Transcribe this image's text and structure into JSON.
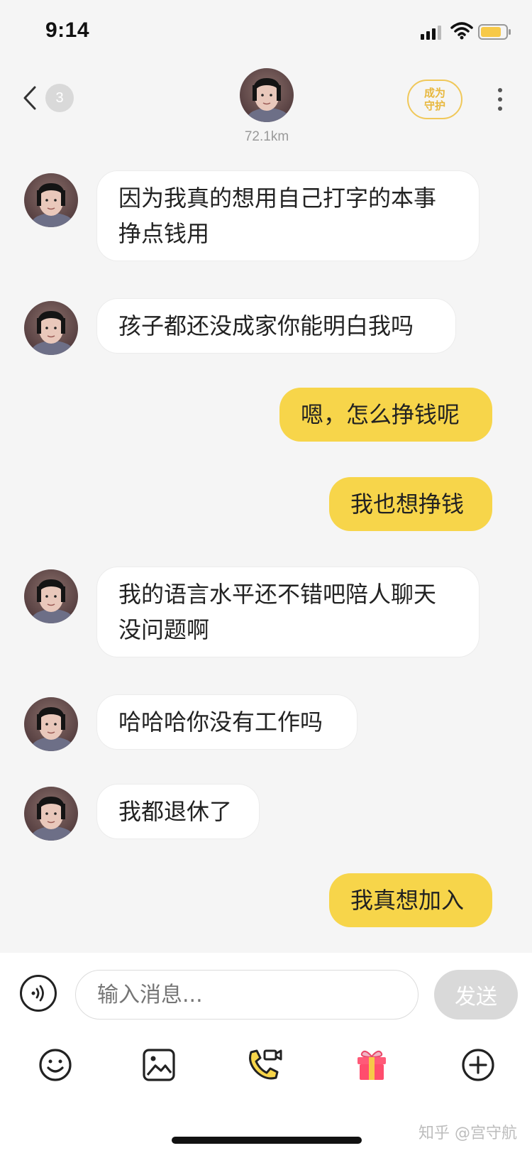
{
  "status_bar": {
    "time": "9:14"
  },
  "header": {
    "unread_count": "3",
    "distance": "72.1km",
    "guard_button": [
      "成为",
      "守护"
    ]
  },
  "messages": [
    {
      "side": "left",
      "text_lines": [
        "因为我真的想用自己打字的本事",
        "挣点钱用"
      ]
    },
    {
      "side": "left",
      "text_lines": [
        "孩子都还没成家你能明白我吗"
      ]
    },
    {
      "side": "right",
      "text_lines": [
        "嗯，怎么挣钱呢"
      ]
    },
    {
      "side": "right",
      "text_lines": [
        "我也想挣钱"
      ]
    },
    {
      "side": "left",
      "text_lines": [
        "我的语言水平还不错吧陪人聊天",
        "没问题啊"
      ]
    },
    {
      "side": "left",
      "text_lines": [
        "哈哈哈你没有工作吗"
      ]
    },
    {
      "side": "left",
      "text_lines": [
        "我都退休了"
      ]
    },
    {
      "side": "right",
      "text_lines": [
        "我真想加入"
      ]
    }
  ],
  "composer": {
    "placeholder": "输入消息...",
    "send_label": "发送"
  },
  "toolbar": {
    "icons": [
      "emoji-icon",
      "image-icon",
      "call-icon",
      "gift-icon",
      "plus-icon"
    ]
  },
  "watermark": "知乎 @宫守航",
  "colors": {
    "accent": "#f7d54a",
    "background": "#f5f5f5",
    "guard": "#e8b83e"
  }
}
